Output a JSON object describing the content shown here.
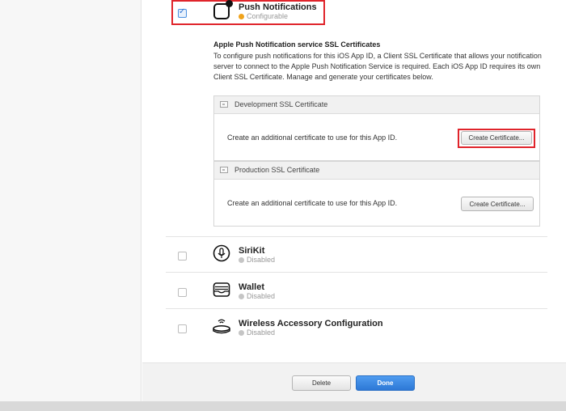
{
  "push": {
    "title": "Push Notifications",
    "status": "Configurable",
    "status_color": "#f0a31b",
    "enabled": true,
    "icon": "push-notification-icon"
  },
  "ssl": {
    "heading": "Apple Push Notification service SSL Certificates",
    "description": "To configure push notifications for this iOS App ID, a Client SSL Certificate that allows your notification server to connect to the Apple Push Notification Service is required. Each iOS App ID requires its own Client SSL Certificate. Manage and generate your certificates below.",
    "development": {
      "title": "Development SSL Certificate",
      "text": "Create an additional certificate to use for this App ID.",
      "button": "Create Certificate..."
    },
    "production": {
      "title": "Production SSL Certificate",
      "text": "Create an additional certificate to use for this App ID.",
      "button": "Create Certificate..."
    }
  },
  "capabilities": [
    {
      "title": "SiriKit",
      "status": "Disabled",
      "icon": "microphone-icon",
      "enabled": false
    },
    {
      "title": "Wallet",
      "status": "Disabled",
      "icon": "wallet-icon",
      "enabled": false
    },
    {
      "title": "Wireless Accessory Configuration",
      "status": "Disabled",
      "icon": "wireless-accessory-icon",
      "enabled": false
    }
  ],
  "footer": {
    "delete_label": "Delete",
    "done_label": "Done",
    "done_color": "#2d78d6"
  },
  "colors": {
    "highlight": "#e0242b",
    "disabled_dot": "#c5c5c5"
  }
}
